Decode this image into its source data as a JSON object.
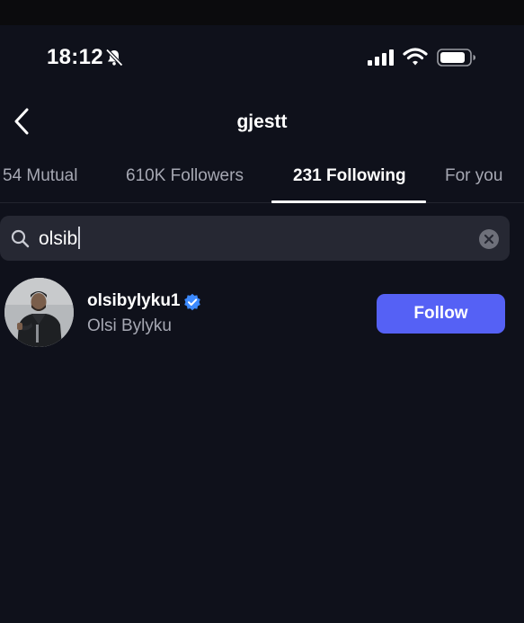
{
  "status_bar": {
    "time": "18:12",
    "icons": [
      "bell-slash-icon",
      "signal-icon",
      "wifi-icon",
      "battery-icon"
    ]
  },
  "header": {
    "title": "gjestt",
    "back_icon": "chevron-left-icon"
  },
  "tabs": [
    {
      "label": "54 Mutual",
      "active": false
    },
    {
      "label": "610K Followers",
      "active": false
    },
    {
      "label": "231 Following",
      "active": true
    },
    {
      "label": "For you",
      "active": false
    }
  ],
  "search": {
    "value": "olsib",
    "icon": "search-icon",
    "clear_icon": "clear-icon"
  },
  "results": [
    {
      "username": "olsibylyku1",
      "verified": true,
      "full_name": "Olsi Bylyku",
      "follow_label": "Follow"
    }
  ],
  "colors": {
    "background": "#0f111b",
    "search_field": "#262833",
    "follow_button": "#5561f5",
    "verified_badge": "#3c8aff",
    "secondary_text": "#a6a8b3"
  }
}
